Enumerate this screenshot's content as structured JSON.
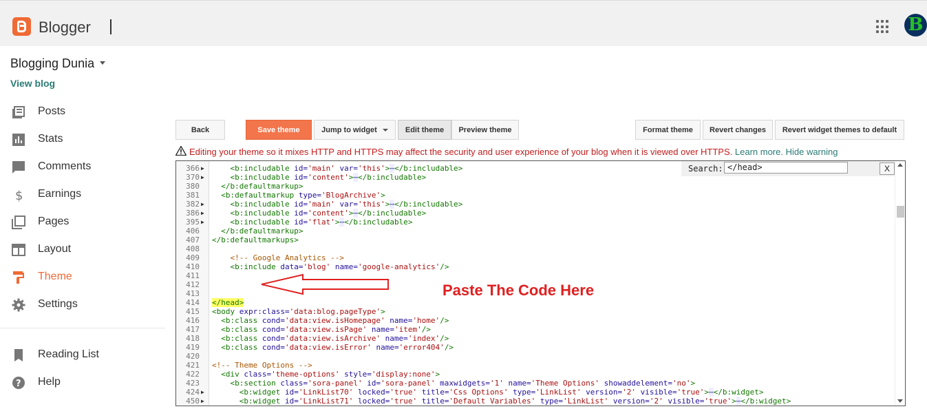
{
  "header": {
    "brand": "Blogger",
    "avatar_letter": "B",
    "accent": "#f06a35"
  },
  "sidebar": {
    "blog_name": "Blogging Dunia",
    "view_blog": "View blog",
    "items": [
      {
        "label": "Posts",
        "icon": "posts-icon"
      },
      {
        "label": "Stats",
        "icon": "stats-icon"
      },
      {
        "label": "Comments",
        "icon": "comments-icon"
      },
      {
        "label": "Earnings",
        "icon": "dollar-icon"
      },
      {
        "label": "Pages",
        "icon": "pages-icon"
      },
      {
        "label": "Layout",
        "icon": "layout-icon"
      },
      {
        "label": "Theme",
        "icon": "paint-roller-icon",
        "active": true
      },
      {
        "label": "Settings",
        "icon": "gear-icon"
      }
    ],
    "secondary": [
      {
        "label": "Reading List",
        "icon": "bookmark-icon"
      },
      {
        "label": "Help",
        "icon": "help-icon"
      }
    ]
  },
  "toolbar": {
    "back": "Back",
    "save_theme": "Save theme",
    "jump_to_widget": "Jump to widget",
    "edit_theme": "Edit theme",
    "preview_theme": "Preview theme",
    "format_theme": "Format theme",
    "revert_changes": "Revert changes",
    "revert_widget_themes": "Revert widget themes to default"
  },
  "warning": {
    "text": "Editing your theme so it mixes HTTP and HTTPS may affect the security and user experience of your blog when it is viewed over HTTPS.",
    "learn_more": "Learn more.",
    "hide_warning": "Hide warning"
  },
  "search": {
    "label": "Search:",
    "value": "</head>",
    "close": "X"
  },
  "annotation": "Paste The Code Here",
  "code_lines": [
    {
      "ln": "366",
      "fold": true
    },
    {
      "ln": "370",
      "fold": true
    },
    {
      "ln": "380",
      "fold": false
    },
    {
      "ln": "381",
      "fold": false
    },
    {
      "ln": "382",
      "fold": true
    },
    {
      "ln": "386",
      "fold": true
    },
    {
      "ln": "395",
      "fold": true
    },
    {
      "ln": "406",
      "fold": false
    },
    {
      "ln": "407",
      "fold": false
    },
    {
      "ln": "408",
      "fold": false
    },
    {
      "ln": "409",
      "fold": false
    },
    {
      "ln": "410",
      "fold": false
    },
    {
      "ln": "411",
      "fold": false
    },
    {
      "ln": "412",
      "fold": false
    },
    {
      "ln": "413",
      "fold": false
    },
    {
      "ln": "414",
      "fold": false
    },
    {
      "ln": "415",
      "fold": false
    },
    {
      "ln": "416",
      "fold": false
    },
    {
      "ln": "417",
      "fold": false
    },
    {
      "ln": "418",
      "fold": false
    },
    {
      "ln": "419",
      "fold": false
    },
    {
      "ln": "420",
      "fold": false
    },
    {
      "ln": "421",
      "fold": false
    },
    {
      "ln": "422",
      "fold": false
    },
    {
      "ln": "423",
      "fold": false
    },
    {
      "ln": "424",
      "fold": true
    },
    {
      "ln": "450",
      "fold": true
    }
  ],
  "code_text": [
    "    <b:includable id='main' var='this'>⋯</b:includable>",
    "    <b:includable id='content'>⋯</b:includable>",
    "  </b:defaultmarkup>",
    "  <b:defaultmarkup type='BlogArchive'>",
    "    <b:includable id='main' var='this'>⋯</b:includable>",
    "    <b:includable id='content'>⋯</b:includable>",
    "    <b:includable id='flat'>⋯</b:includable>",
    "  </b:defaultmarkup>",
    "</b:defaultmarkups>",
    "",
    "    <!-- Google Analytics -->",
    "    <b:include data='blog' name='google-analytics'/>",
    "",
    "",
    "",
    "</head>",
    "<body expr:class='data:blog.pageType'>",
    "  <b:class cond='data:view.isHomepage' name='home'/>",
    "  <b:class cond='data:view.isPage' name='item'/>",
    "  <b:class cond='data:view.isArchive' name='index'/>",
    "  <b:class cond='data:view.isError' name='error404'/>",
    "",
    "<!-- Theme Options -->",
    "  <div class='theme-options' style='display:none'>",
    "    <b:section class='sora-panel' id='sora-panel' maxwidgets='1' name='Theme Options' showaddelement='no'>",
    "      <b:widget id='LinkList70' locked='true' title='Css Options' type='LinkList' version='2' visible='true'>⋯</b:widget>",
    "      <b:widget id='LinkList71' locked='true' title='Default Variables' type='LinkList' version='2' visible='true'>⋯</b:widget>"
  ]
}
